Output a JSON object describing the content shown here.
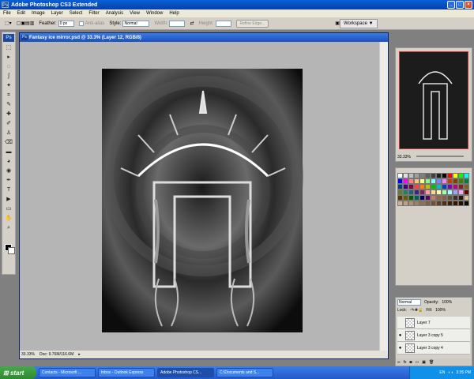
{
  "app": {
    "title": "Adobe Photoshop CS3 Extended",
    "icon": "Ps",
    "window_buttons": [
      "_",
      "□",
      "×"
    ]
  },
  "menu": [
    "File",
    "Edit",
    "Image",
    "Layer",
    "Select",
    "Filter",
    "Analysis",
    "View",
    "Window",
    "Help"
  ],
  "options": {
    "feather_label": "Feather:",
    "feather_value": "0 px",
    "antialias_label": "Anti-alias",
    "style_label": "Style:",
    "style_value": "Normal",
    "width_label": "Width:",
    "height_label": "Height:",
    "refine_label": "Refine Edge...",
    "workspace_label": "Workspace ▼"
  },
  "tools": [
    "⬚",
    "▸",
    "◌",
    "ʃ",
    "✦",
    "⌗",
    "✎",
    "✚",
    "✐",
    "♙",
    "⌫",
    "▬",
    "◕",
    "◉",
    "✒",
    "T",
    "▶",
    "▭",
    "✋",
    "⌕"
  ],
  "tool_icons": [
    "marquee-tool-icon",
    "move-tool-icon",
    "lasso-tool-icon",
    "quick-select-icon",
    "magic-wand-icon",
    "crop-tool-icon",
    "brush-tool-icon",
    "heal-tool-icon",
    "pencil-tool-icon",
    "clone-stamp-icon",
    "eraser-tool-icon",
    "gradient-tool-icon",
    "blur-tool-icon",
    "dodge-tool-icon",
    "pen-tool-icon",
    "type-tool-icon",
    "path-select-icon",
    "shape-tool-icon",
    "hand-tool-icon",
    "zoom-tool-icon"
  ],
  "document": {
    "title": "Fantasy ice mirror.psd @ 33.3% (Layer 12, RGB/8)",
    "zoom": "33.33%",
    "doc_size": "Doc: 9.76M/116.6M"
  },
  "navigator": {
    "zoom": "33.33%"
  },
  "swatches": [
    "#ffffff",
    "#e0e0e0",
    "#c0c0c0",
    "#a0a0a0",
    "#808080",
    "#606060",
    "#404040",
    "#202020",
    "#000000",
    "#ff0000",
    "#ffff00",
    "#00ff00",
    "#00ffff",
    "#0000ff",
    "#ff00ff",
    "#ff8080",
    "#ffc080",
    "#ffff80",
    "#80ff80",
    "#80ffff",
    "#8080ff",
    "#ff80ff",
    "#c04000",
    "#804000",
    "#408000",
    "#008040",
    "#004080",
    "#400080",
    "#800040",
    "#ff4040",
    "#ff8000",
    "#c0c000",
    "#00c000",
    "#00c0c0",
    "#0040c0",
    "#8000c0",
    "#c00080",
    "#802020",
    "#806020",
    "#608020",
    "#208060",
    "#206080",
    "#402080",
    "#802060",
    "#ffa0a0",
    "#ffd0a0",
    "#ffffa0",
    "#a0ffa0",
    "#a0ffff",
    "#a0a0ff",
    "#ffa0ff",
    "#600000",
    "#603000",
    "#606000",
    "#006000",
    "#006060",
    "#000060",
    "#600060",
    "#c08060",
    "#a06040",
    "#80604a",
    "#605040",
    "#403020",
    "#201810",
    "#e0c0a0",
    "#d0b090",
    "#c0a080",
    "#b09070",
    "#a08060",
    "#907050",
    "#806040",
    "#705030",
    "#604020",
    "#503010",
    "#402000",
    "#301800",
    "#201000",
    "#100800"
  ],
  "layers": {
    "blend_mode": "Normal",
    "opacity_label": "Opacity:",
    "opacity_value": "100%",
    "lock_label": "Lock:",
    "fill_label": "Fill:",
    "fill_value": "100%",
    "items": [
      {
        "name": "Layer 7",
        "visible": false
      },
      {
        "name": "Layer 3 copy 5",
        "visible": true
      },
      {
        "name": "Layer 3 copy 4",
        "visible": true
      }
    ]
  },
  "taskbar": {
    "start": "start",
    "tasks": [
      "Contacts - Microsoft ...",
      "Inbox - Outlook Express",
      "Adobe Photoshop CS...",
      "C:\\Documents and S..."
    ],
    "active_index": 2,
    "tray_lang": "EN",
    "clock": "3:35 PM"
  }
}
